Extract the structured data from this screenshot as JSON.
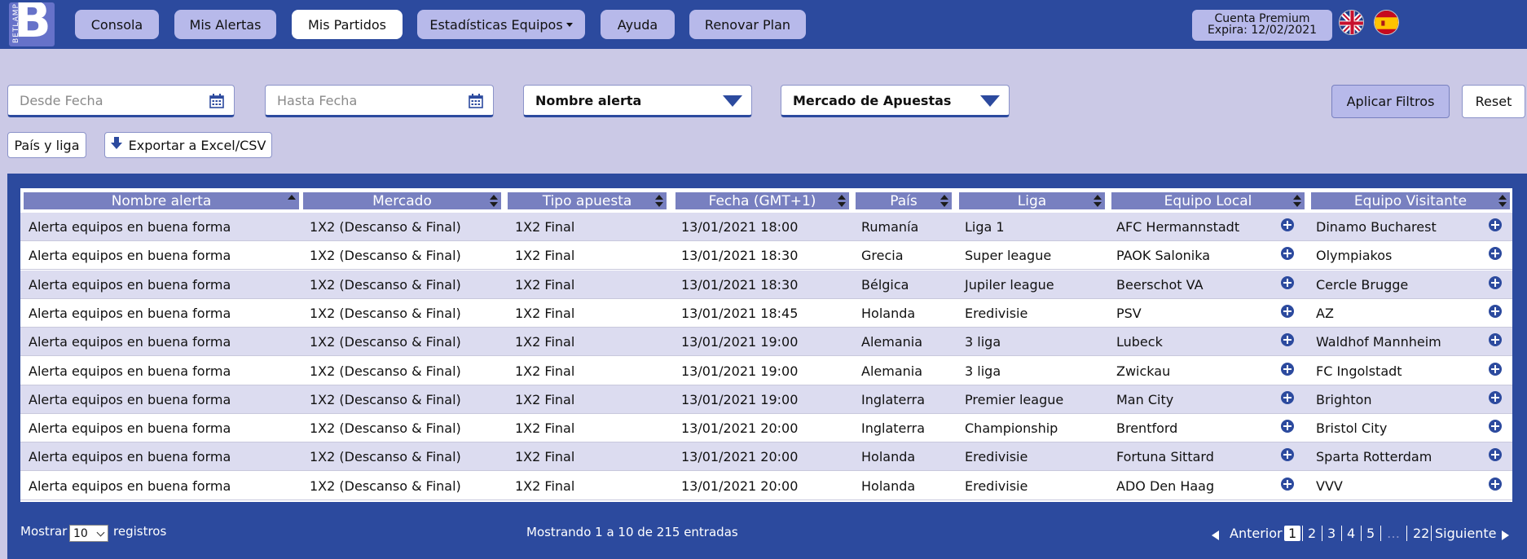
{
  "brand": {
    "logo_letter": "B",
    "logo_text": "BETLAMP"
  },
  "nav": {
    "items": [
      {
        "label": "Consola",
        "active": false
      },
      {
        "label": "Mis Alertas",
        "active": false
      },
      {
        "label": "Mis Partidos",
        "active": true
      },
      {
        "label": "Estadísticas Equipos",
        "active": false,
        "dropdown": true
      },
      {
        "label": "Ayuda",
        "active": false
      },
      {
        "label": "Renovar Plan",
        "active": false
      }
    ],
    "account": {
      "line1": "Cuenta Premium",
      "line2": "Expira: 12/02/2021"
    },
    "languages": [
      "uk-flag-icon",
      "spain-flag-icon"
    ]
  },
  "filters": {
    "desde_placeholder": "Desde Fecha",
    "hasta_placeholder": "Hasta Fecha",
    "alert_select": "Nombre alerta",
    "market_select": "Mercado de Apuestas",
    "apply_label": "Aplicar Filtros",
    "reset_label": "Reset",
    "country_label": "País y liga",
    "export_label": "Exportar a Excel/CSV"
  },
  "table": {
    "columns": [
      "Nombre alerta",
      "Mercado",
      "Tipo apuesta",
      "Fecha (GMT+1)",
      "País",
      "Liga",
      "Equipo Local",
      "Equipo Visitante"
    ],
    "rows": [
      [
        "Alerta equipos en buena forma",
        "1X2 (Descanso & Final)",
        "1X2 Final",
        "13/01/2021 18:00",
        "Rumanía",
        "Liga 1",
        "AFC Hermannstadt",
        "Dinamo Bucharest"
      ],
      [
        "Alerta equipos en buena forma",
        "1X2 (Descanso & Final)",
        "1X2 Final",
        "13/01/2021 18:30",
        "Grecia",
        "Super league",
        "PAOK Salonika",
        "Olympiakos"
      ],
      [
        "Alerta equipos en buena forma",
        "1X2 (Descanso & Final)",
        "1X2 Final",
        "13/01/2021 18:30",
        "Bélgica",
        "Jupiler league",
        "Beerschot VA",
        "Cercle Brugge"
      ],
      [
        "Alerta equipos en buena forma",
        "1X2 (Descanso & Final)",
        "1X2 Final",
        "13/01/2021 18:45",
        "Holanda",
        "Eredivisie",
        "PSV",
        "AZ"
      ],
      [
        "Alerta equipos en buena forma",
        "1X2 (Descanso & Final)",
        "1X2 Final",
        "13/01/2021 19:00",
        "Alemania",
        "3 liga",
        "Lubeck",
        "Waldhof Mannheim"
      ],
      [
        "Alerta equipos en buena forma",
        "1X2 (Descanso & Final)",
        "1X2 Final",
        "13/01/2021 19:00",
        "Alemania",
        "3 liga",
        "Zwickau",
        "FC Ingolstadt"
      ],
      [
        "Alerta equipos en buena forma",
        "1X2 (Descanso & Final)",
        "1X2 Final",
        "13/01/2021 19:00",
        "Inglaterra",
        "Premier league",
        "Man City",
        "Brighton"
      ],
      [
        "Alerta equipos en buena forma",
        "1X2 (Descanso & Final)",
        "1X2 Final",
        "13/01/2021 20:00",
        "Inglaterra",
        "Championship",
        "Brentford",
        "Bristol City"
      ],
      [
        "Alerta equipos en buena forma",
        "1X2 (Descanso & Final)",
        "1X2 Final",
        "13/01/2021 20:00",
        "Holanda",
        "Eredivisie",
        "Fortuna Sittard",
        "Sparta Rotterdam"
      ],
      [
        "Alerta equipos en buena forma",
        "1X2 (Descanso & Final)",
        "1X2 Final",
        "13/01/2021 20:00",
        "Holanda",
        "Eredivisie",
        "ADO Den Haag",
        "VVV"
      ]
    ]
  },
  "footer": {
    "show_prefix": "Mostrar",
    "show_value": "10",
    "show_suffix": "registros",
    "info": "Mostrando 1 a 10 de 215 entradas",
    "prev": "Anterior",
    "next": "Siguiente",
    "pages": [
      "1",
      "2",
      "3",
      "4",
      "5",
      "…",
      "22"
    ],
    "current_page": "1"
  },
  "colors": {
    "primary": "#2c4a9e",
    "background": "#cbc9e6",
    "button": "#b7b9ea",
    "header_cell": "#7880c0",
    "row_alt": "#dcdcf0"
  }
}
